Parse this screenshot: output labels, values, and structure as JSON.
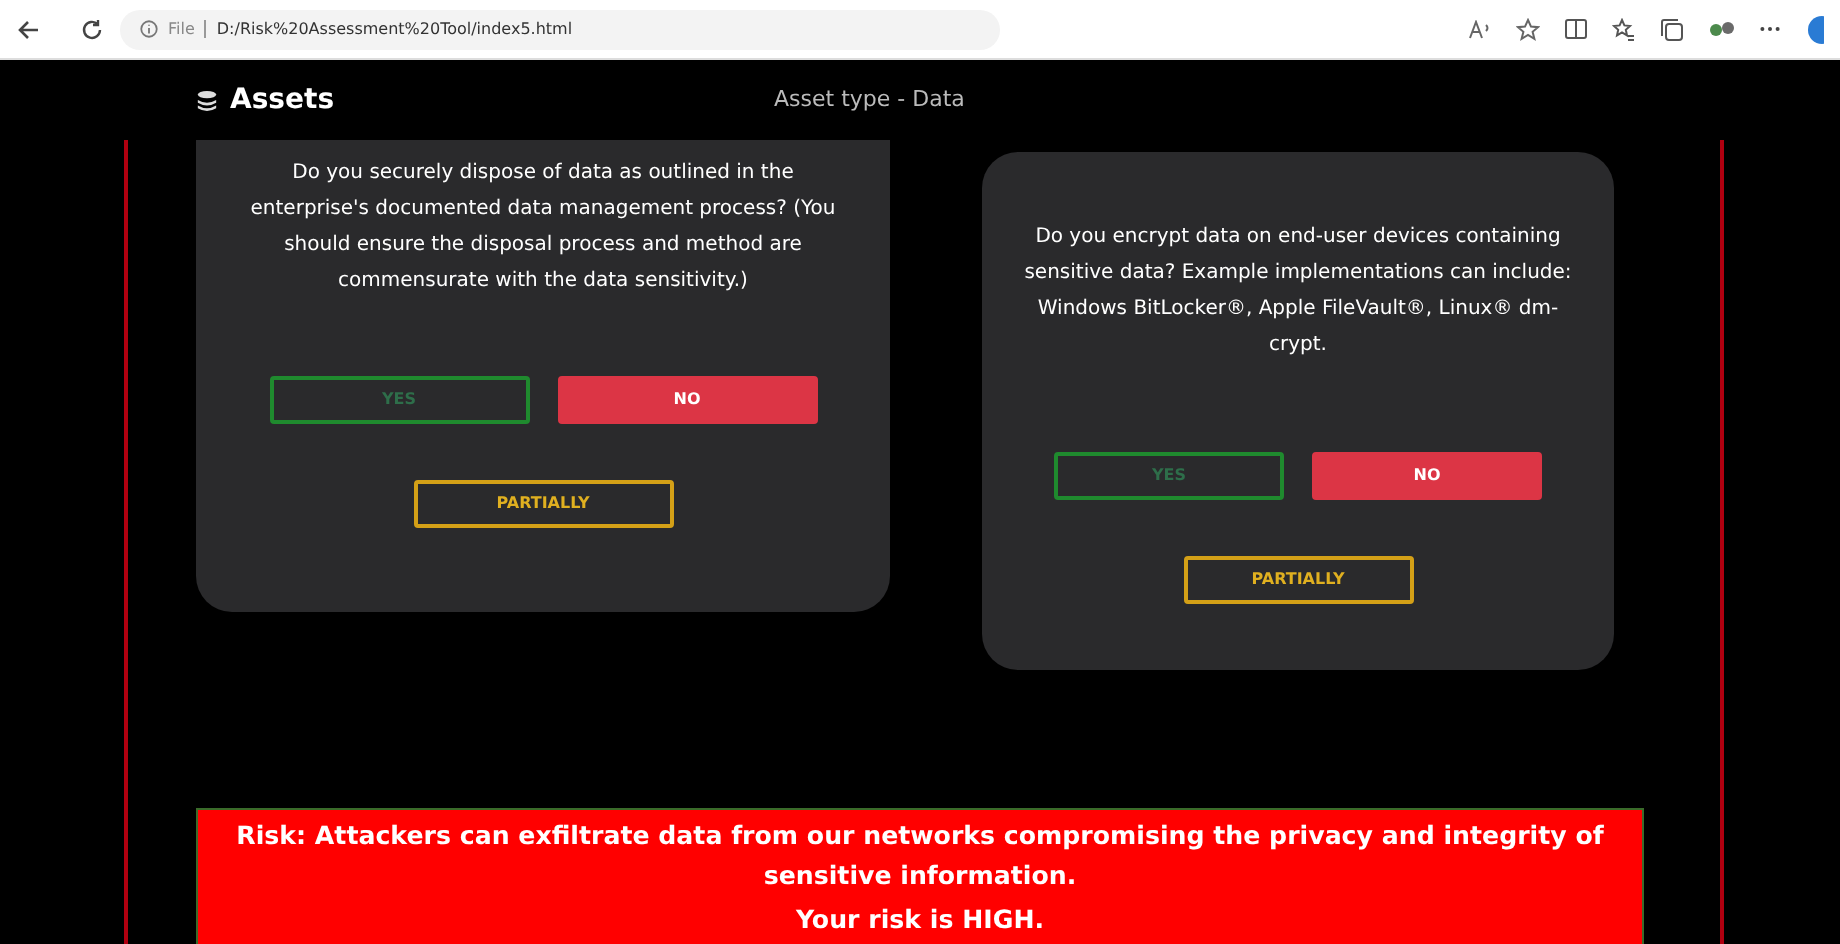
{
  "browser": {
    "scheme": "File",
    "url": "D:/Risk%20Assessment%20Tool/index5.html"
  },
  "header": {
    "title": "Assets",
    "subtitle": "Asset type - Data"
  },
  "questions": [
    {
      "text": "Do you securely dispose of data as outlined in the enterprise's documented data management process? (You should ensure the disposal process and method are commensurate with the data sensitivity.)",
      "answers": [
        {
          "label": "YES",
          "kind": "yes",
          "selected": false
        },
        {
          "label": "NO",
          "kind": "no",
          "selected": true
        },
        {
          "label": "PARTIALLY",
          "kind": "partial",
          "selected": false
        }
      ]
    },
    {
      "text": "Do you encrypt data on end-user devices containing sensitive data? Example implementations can include: Windows BitLocker®, Apple FileVault®, Linux® dm-crypt.",
      "answers": [
        {
          "label": "YES",
          "kind": "yes",
          "selected": false
        },
        {
          "label": "NO",
          "kind": "no",
          "selected": true
        },
        {
          "label": "PARTIALLY",
          "kind": "partial",
          "selected": false
        }
      ]
    }
  ],
  "risk": {
    "statement": "Risk: Attackers can exfiltrate data from our networks compromising the privacy and integrity of sensitive information.",
    "level_text": "Your risk is HIGH."
  }
}
